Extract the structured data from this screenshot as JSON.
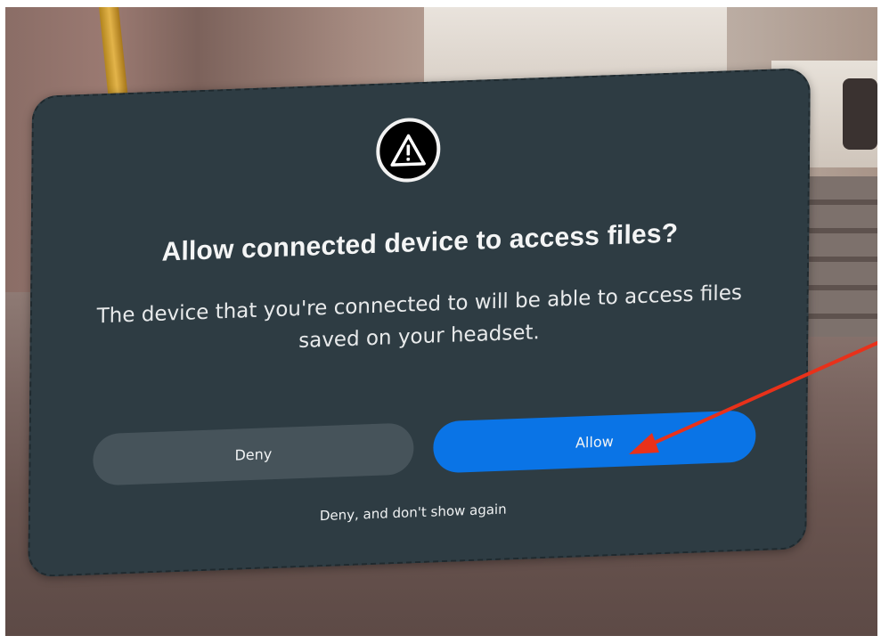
{
  "dialog": {
    "icon": "warning-triangle-icon",
    "title": "Allow connected device to access files?",
    "body": "The device that you're connected to will be able to access files saved on your headset.",
    "deny_label": "Deny",
    "allow_label": "Allow",
    "dont_show_label": "Deny, and don't show again"
  },
  "annotation": {
    "icon": "red-arrow-icon",
    "color": "#e8311a"
  },
  "colors": {
    "dialog_bg": "#2e3c43",
    "deny_bg": "#46535a",
    "allow_bg": "#0a74e6"
  }
}
